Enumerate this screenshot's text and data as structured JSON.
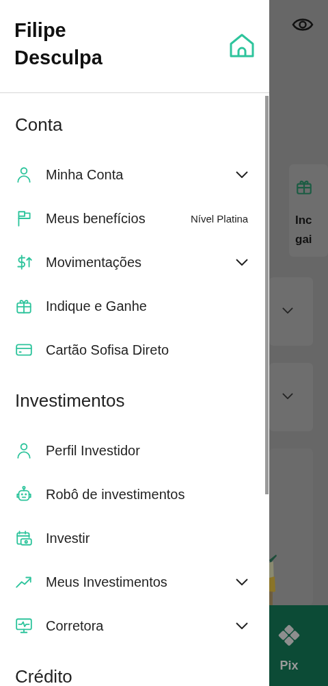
{
  "drawer": {
    "user_name": "Filipe Desculpa",
    "sections": [
      {
        "title": "Conta",
        "items": [
          {
            "label": "Minha Conta",
            "expandable": true
          },
          {
            "label": "Meus benefícios",
            "badge": "Nível Platina",
            "expandable": false
          },
          {
            "label": "Movimentações",
            "expandable": true
          },
          {
            "label": "Indique e Ganhe",
            "expandable": false
          },
          {
            "label": "Cartão Sofisa Direto",
            "expandable": false
          }
        ]
      },
      {
        "title": "Investimentos",
        "items": [
          {
            "label": "Perfil Investidor",
            "expandable": false
          },
          {
            "label": "Robô de investimentos",
            "expandable": false
          },
          {
            "label": "Investir",
            "expandable": false
          },
          {
            "label": "Meus Investimentos",
            "expandable": true
          },
          {
            "label": "Corretora",
            "expandable": true
          }
        ]
      },
      {
        "title": "Crédito"
      }
    ]
  },
  "background_screen": {
    "card_text": [
      "Inc",
      "gai"
    ],
    "nav_label": "Pix"
  }
}
